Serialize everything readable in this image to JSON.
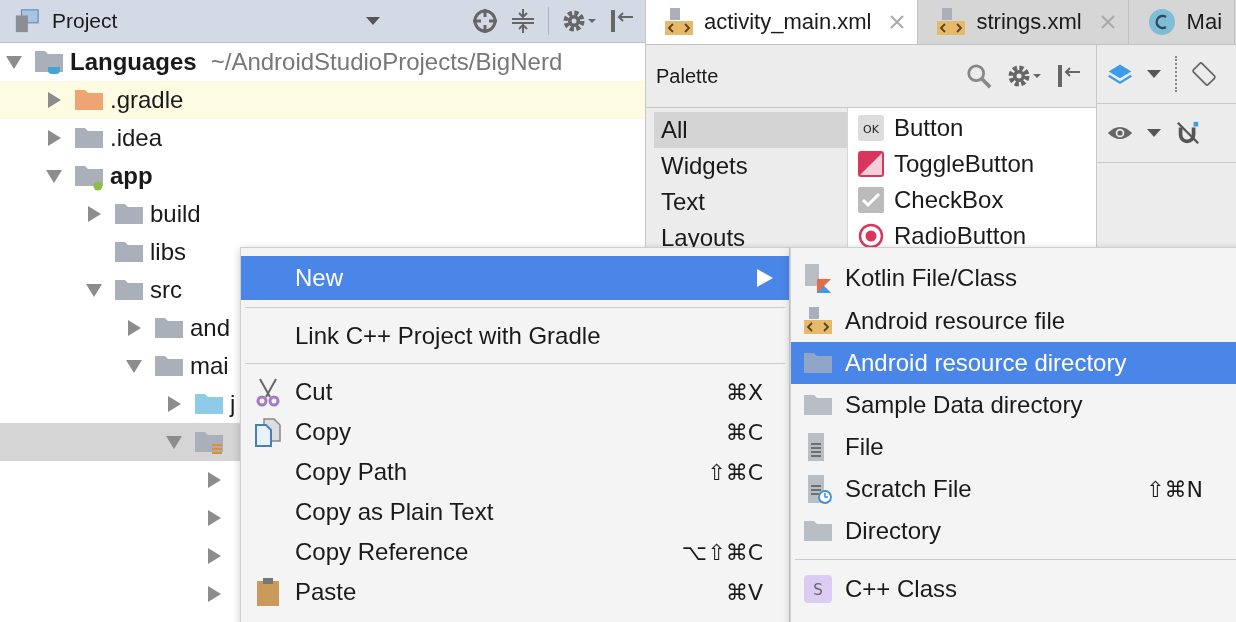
{
  "project_panel": {
    "title": "Project",
    "tree": [
      {
        "label": "Languages",
        "path": "~/AndroidStudioProjects/BigNerd",
        "kind": "project",
        "bold": true,
        "expanded": true,
        "selected": false,
        "highlighted": false,
        "children": [
          {
            "label": ".gradle",
            "kind": "excluded",
            "expanded": false,
            "selected": false,
            "highlighted": true
          },
          {
            "label": ".idea",
            "kind": "folder",
            "expanded": false,
            "selected": false,
            "highlighted": false
          },
          {
            "label": "app",
            "kind": "module",
            "bold": true,
            "expanded": true,
            "selected": false,
            "highlighted": false,
            "children": [
              {
                "label": "build",
                "kind": "folder",
                "expanded": false,
                "selected": false,
                "highlighted": false
              },
              {
                "label": "libs",
                "kind": "folder",
                "selected": false,
                "highlighted": false
              },
              {
                "label": "src",
                "kind": "folder",
                "expanded": true,
                "selected": false,
                "highlighted": false,
                "children": [
                  {
                    "label": "and",
                    "kind": "folder",
                    "expanded": false,
                    "selected": false,
                    "highlighted": false
                  },
                  {
                    "label": "mai",
                    "kind": "folder",
                    "expanded": true,
                    "selected": false,
                    "highlighted": false,
                    "children": [
                      {
                        "label": "j",
                        "kind": "source",
                        "expanded": false,
                        "selected": false,
                        "highlighted": false
                      },
                      {
                        "kind": "resources",
                        "expanded": true,
                        "selected": true,
                        "highlighted": false,
                        "children": [
                          {
                            "expanded": false,
                            "selected": false,
                            "highlighted": false
                          },
                          {
                            "expanded": false,
                            "selected": false,
                            "highlighted": false
                          },
                          {
                            "expanded": false,
                            "selected": false,
                            "highlighted": false
                          },
                          {
                            "expanded": false,
                            "selected": false,
                            "highlighted": false
                          }
                        ]
                      }
                    ]
                  }
                ]
              }
            ]
          }
        ]
      }
    ]
  },
  "editor_tabs": [
    {
      "label": "activity_main.xml",
      "kind": "xml",
      "selected": true,
      "closable": true
    },
    {
      "label": "strings.xml",
      "kind": "xml",
      "selected": false,
      "closable": true
    },
    {
      "label": "Mai",
      "kind": "class",
      "selected": false,
      "closable": false
    }
  ],
  "palette": {
    "title": "Palette",
    "categories": [
      {
        "label": "All",
        "selected": true
      },
      {
        "label": "Widgets",
        "selected": false
      },
      {
        "label": "Text",
        "selected": false
      },
      {
        "label": "Layouts",
        "selected": false
      }
    ],
    "items": [
      {
        "label": "Button",
        "kind": "button",
        "icon_text": "OK"
      },
      {
        "label": "ToggleButton",
        "kind": "toggle"
      },
      {
        "label": "CheckBox",
        "kind": "checkbox"
      },
      {
        "label": "RadioButton",
        "kind": "radio"
      }
    ]
  },
  "context_menu": [
    {
      "kind": "submenu",
      "label": "New",
      "selected": true
    },
    {
      "kind": "separator"
    },
    {
      "kind": "plain",
      "label": "Link C++ Project with Gradle",
      "selected": false
    },
    {
      "kind": "separator"
    },
    {
      "kind": "cut",
      "label": "Cut",
      "shortcut": "⌘X",
      "selected": false
    },
    {
      "kind": "copy",
      "label": "Copy",
      "shortcut": "⌘C",
      "selected": false
    },
    {
      "kind": "plain",
      "label": "Copy Path",
      "shortcut": "⇧⌘C",
      "selected": false
    },
    {
      "kind": "plain",
      "label": "Copy as Plain Text",
      "selected": false
    },
    {
      "kind": "plain",
      "label": "Copy Reference",
      "shortcut": "⌥⇧⌘C",
      "selected": false
    },
    {
      "kind": "paste",
      "label": "Paste",
      "shortcut": "⌘V",
      "selected": false
    }
  ],
  "new_submenu": [
    {
      "kind": "kotlin",
      "label": "Kotlin File/Class",
      "selected": false
    },
    {
      "kind": "xml",
      "label": "Android resource file",
      "selected": false
    },
    {
      "kind": "folder",
      "label": "Android resource directory",
      "selected": true
    },
    {
      "kind": "folder",
      "label": "Sample Data directory",
      "selected": false
    },
    {
      "kind": "file",
      "label": "File",
      "selected": false
    },
    {
      "kind": "scratch",
      "label": "Scratch File",
      "shortcut": "⇧⌘N",
      "selected": false
    },
    {
      "kind": "folder",
      "label": "Directory",
      "selected": false
    },
    {
      "kind": "separator"
    },
    {
      "kind": "cpp",
      "label": "C++ Class",
      "icon_text": "S",
      "selected": false
    }
  ]
}
